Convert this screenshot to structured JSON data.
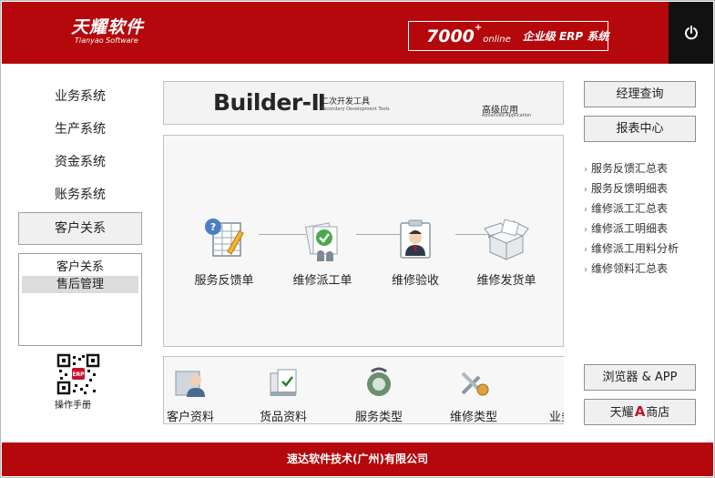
{
  "header": {
    "logo_cn": "天耀软件",
    "logo_en": "Tianyao Software",
    "product_num": "7000",
    "product_sup": "+",
    "product_suffix": "online",
    "product_desc": "企业级 ERP 系统",
    "power_icon": "power-icon"
  },
  "left_nav": {
    "items": [
      "业务系统",
      "生产系统",
      "资金系统",
      "账务系统",
      "客户关系"
    ],
    "active": "客户关系",
    "sub_items": [
      "客户关系",
      "售后管理"
    ],
    "selected_sub": "售后管理",
    "manual_label": "操作手册"
  },
  "banner": {
    "main": "Builder-Ⅱ",
    "cn": "二次开发工具",
    "en": "Secondary Development Tools",
    "adv": "高级应用",
    "adv_en": "Advanced Application"
  },
  "flow": {
    "items": [
      {
        "label": "服务反馈单",
        "icon": "feedback-form-icon"
      },
      {
        "label": "维修派工单",
        "icon": "dispatch-order-icon"
      },
      {
        "label": "维修验收",
        "icon": "inspection-icon"
      },
      {
        "label": "维修发货单",
        "icon": "shipping-box-icon"
      }
    ]
  },
  "strip": {
    "items": [
      {
        "label": "客户资料",
        "icon": "customer-icon"
      },
      {
        "label": "货品资料",
        "icon": "goods-icon"
      },
      {
        "label": "服务类型",
        "icon": "service-type-icon"
      },
      {
        "label": "维修类型",
        "icon": "repair-type-icon"
      },
      {
        "label": "业务",
        "icon": "business-icon"
      }
    ]
  },
  "right": {
    "manager_query": "经理查询",
    "report_center": "报表中心",
    "reports": [
      "服务反馈汇总表",
      "服务反馈明细表",
      "维修派工汇总表",
      "维修派工明细表",
      "维修派工用料分析",
      "维修领料汇总表"
    ],
    "browser_app": "浏览器 & APP",
    "store": "天耀",
    "store_suffix": "商店",
    "store_logo": "A"
  },
  "footer": {
    "company": "速达软件技术(广州)有限公司"
  },
  "colors": {
    "brand_red": "#b5080c",
    "power_bg": "#111111"
  }
}
